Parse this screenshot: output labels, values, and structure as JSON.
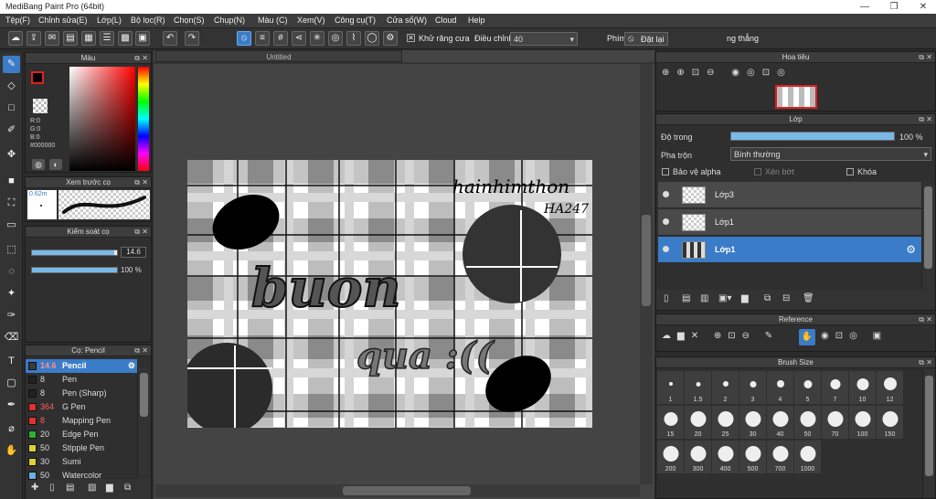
{
  "title": "MediBang Paint Pro (64bit)",
  "menu": [
    "Tệp(F)",
    "Chỉnh sửa(E)",
    "Lớp(L)",
    "Bộ lọc(R)",
    "Chọn(S)",
    "Chụp(N)",
    "Màu (C)",
    "Xem(V)",
    "Công cụ(T)",
    "Cửa sổ(W)",
    "Cloud",
    "Help"
  ],
  "toolbar": {
    "antialias_label": "Khử răng cưa",
    "adjust_label": "Điều chỉnh",
    "adjust_value": "40",
    "key_label": "Phím",
    "reset_label": "Đặt lại",
    "straight_label": "ng thẳng"
  },
  "document": {
    "tab": "Untitled",
    "text_signature": "hainhimthon",
    "text_signature2": "HA247",
    "text_word1": "buon",
    "text_word2": "qua :(("
  },
  "color_panel": {
    "title": "Màu",
    "r": "R:0",
    "g": "G:0",
    "b": "B:0",
    "hex": "#000000"
  },
  "brush_preview": {
    "title": "Xem trước cọ",
    "size": "0.62m"
  },
  "brush_control": {
    "title": "Kiểm soát cọ",
    "size_value": "14.6",
    "size_fill": 0.97,
    "opacity_value": "100 %",
    "opacity_fill": 1.0
  },
  "brush_list": {
    "title": "Cọ: Pencil",
    "items": [
      {
        "size": "14.6",
        "name": "Pencil",
        "color": "#3a3a3a",
        "selected": true
      },
      {
        "size": "8",
        "name": "Pen",
        "color": "#222222"
      },
      {
        "size": "8",
        "name": "Pen (Sharp)",
        "color": "#222222"
      },
      {
        "size": "364",
        "name": "G Pen",
        "color": "#e03030"
      },
      {
        "size": "8",
        "name": "Mapping Pen",
        "color": "#e03030"
      },
      {
        "size": "20",
        "name": "Edge Pen",
        "color": "#30b030"
      },
      {
        "size": "50",
        "name": "Stipple Pen",
        "color": "#e0d030"
      },
      {
        "size": "30",
        "name": "Sumi",
        "color": "#e0d030"
      },
      {
        "size": "50",
        "name": "Watercolor",
        "color": "#6ab0e0"
      }
    ]
  },
  "navigator": {
    "title": "Hoa tiêu"
  },
  "layer_panel": {
    "title": "Lớp",
    "opacity_label": "Độ trong",
    "opacity_value": "100 %",
    "opacity_fill": 1.0,
    "blend_label": "Pha trộn",
    "blend_value": "Bình thường",
    "protect_alpha": "Bảo vệ alpha",
    "clipping": "Xén bớt",
    "lock": "Khóa",
    "layers": [
      {
        "name": "Lớp3"
      },
      {
        "name": "Lớp1"
      },
      {
        "name": "Lớp1",
        "selected": true
      }
    ]
  },
  "reference": {
    "title": "Reference"
  },
  "brush_size": {
    "title": "Brush Size",
    "sizes": [
      "1",
      "1.5",
      "2",
      "3",
      "4",
      "5",
      "7",
      "10",
      "12",
      "15",
      "20",
      "25",
      "30",
      "40",
      "50",
      "70",
      "100",
      "150",
      "200",
      "300",
      "400",
      "500",
      "700",
      "1000"
    ]
  }
}
